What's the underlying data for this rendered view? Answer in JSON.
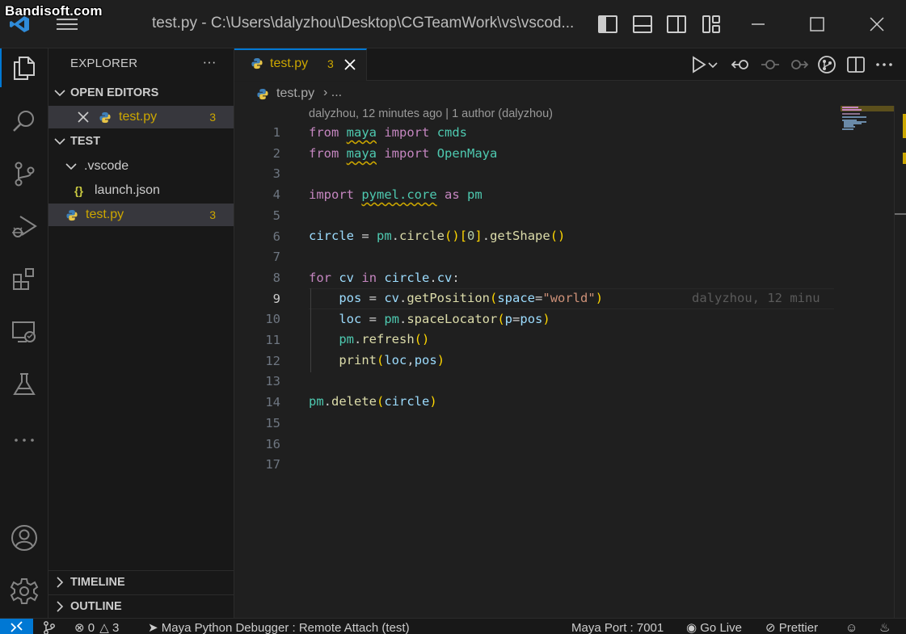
{
  "watermark": "Bandisoft.com",
  "window": {
    "title": "test.py - C:\\Users\\dalyzhou\\Desktop\\CGTeamWork\\vs\\vscod..."
  },
  "sidebar": {
    "title": "EXPLORER",
    "more": "···",
    "open_editors": {
      "label": "OPEN EDITORS",
      "items": [
        {
          "name": "test.py",
          "badge": "3"
        }
      ]
    },
    "folder": {
      "label": "TEST",
      "children": [
        {
          "name": ".vscode",
          "type": "folder"
        },
        {
          "name": "launch.json",
          "type": "json",
          "icon": "{}"
        },
        {
          "name": "test.py",
          "type": "python",
          "badge": "3"
        }
      ]
    },
    "timeline": "TIMELINE",
    "outline": "OUTLINE"
  },
  "tab": {
    "label": "test.py",
    "badge": "3"
  },
  "breadcrumb": {
    "file": "test.py",
    "separator": "› ..."
  },
  "editor": {
    "blame_header": "dalyzhou, 12 minutes ago | 1 author (dalyzhou)",
    "current_line": 9,
    "inline_blame": "dalyzhou, 12 minu",
    "line_numbers": [
      "1",
      "2",
      "3",
      "4",
      "5",
      "6",
      "7",
      "8",
      "9",
      "10",
      "11",
      "12",
      "13",
      "14",
      "15",
      "16",
      "17"
    ]
  },
  "statusbar": {
    "errors": "0",
    "warnings": "3",
    "debug": "Maya Python Debugger : Remote Attach (test)",
    "maya_port": "Maya Port : 7001",
    "go_live": "Go Live",
    "prettier": "Prettier"
  },
  "colors": {
    "accent": "#0078d4",
    "warning": "#cca700",
    "keyword": "#c586c0",
    "variable": "#9cdcfe",
    "function": "#dcdcaa",
    "module": "#4ec9b0",
    "string": "#ce9178"
  }
}
